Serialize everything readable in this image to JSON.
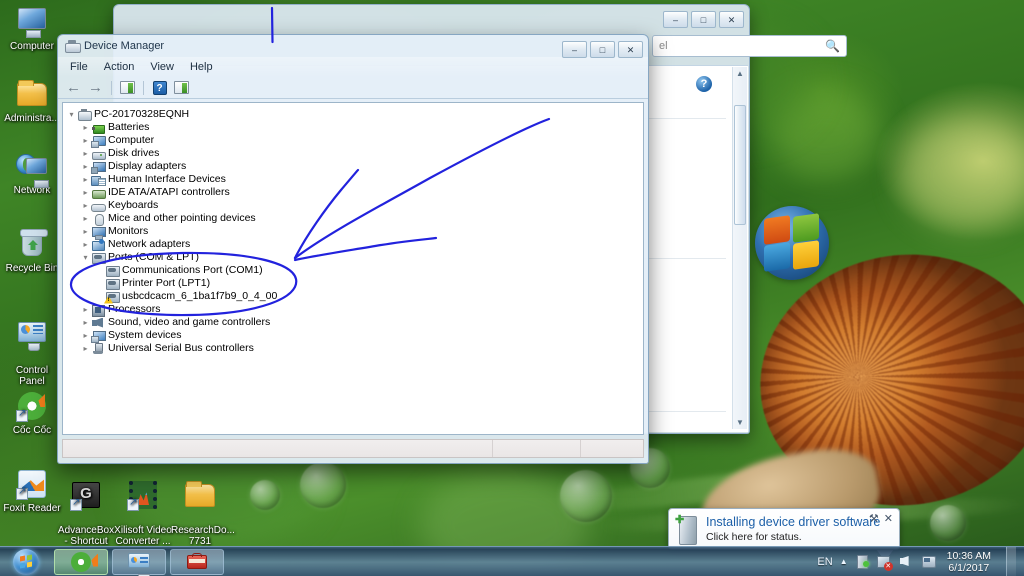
{
  "desktop": {
    "icons": [
      {
        "name": "computer",
        "label": "Computer"
      },
      {
        "name": "administrator-folder",
        "label": "Administra..."
      },
      {
        "name": "network",
        "label": "Network"
      },
      {
        "name": "recycle-bin",
        "label": "Recycle Bin"
      },
      {
        "name": "control-panel",
        "label": "Control\nPanel"
      },
      {
        "name": "coc-coc",
        "label": "Cốc Cốc"
      },
      {
        "name": "foxit-reader",
        "label": "Foxit Reader"
      },
      {
        "name": "advancebox-shortcut",
        "label": "AdvanceBox\n- Shortcut"
      },
      {
        "name": "xilisoft-video-converter",
        "label": "Xilisoft Video\nConverter ..."
      },
      {
        "name": "research-docs-folder",
        "label": "ResearchDo...\n7731"
      }
    ]
  },
  "background_window": {
    "search_placeholder": "",
    "search_value": "el",
    "buttons": {
      "minimize": "–",
      "maximize": "□",
      "close": "✕"
    },
    "help_label": "?"
  },
  "device_manager": {
    "title": "Device Manager",
    "window_buttons": {
      "minimize": "–",
      "maximize": "□",
      "close": "✕"
    },
    "menu": [
      "File",
      "Action",
      "View",
      "Help"
    ],
    "toolbar": [
      {
        "name": "back-arrow-button",
        "glyph": "←"
      },
      {
        "name": "forward-arrow-button",
        "glyph": "→"
      },
      {
        "name": "properties-button",
        "glyph": ""
      },
      {
        "name": "help-button",
        "glyph": "?"
      },
      {
        "name": "scan-hardware-button",
        "glyph": ""
      }
    ],
    "tree": [
      {
        "label": "PC-20170328EQNH",
        "depth": 0,
        "expander": "▾",
        "icon": "ic-pc",
        "warn": false
      },
      {
        "label": "Batteries",
        "depth": 1,
        "expander": "▸",
        "icon": "ic-batt",
        "warn": false
      },
      {
        "label": "Computer",
        "depth": 1,
        "expander": "▸",
        "icon": "ic-comp",
        "warn": false
      },
      {
        "label": "Disk drives",
        "depth": 1,
        "expander": "▸",
        "icon": "ic-disk",
        "warn": false
      },
      {
        "label": "Display adapters",
        "depth": 1,
        "expander": "▸",
        "icon": "ic-disp",
        "warn": false
      },
      {
        "label": "Human Interface Devices",
        "depth": 1,
        "expander": "▸",
        "icon": "ic-hid",
        "warn": false
      },
      {
        "label": "IDE ATA/ATAPI controllers",
        "depth": 1,
        "expander": "▸",
        "icon": "ic-ide",
        "warn": false
      },
      {
        "label": "Keyboards",
        "depth": 1,
        "expander": "▸",
        "icon": "ic-key",
        "warn": false
      },
      {
        "label": "Mice and other pointing devices",
        "depth": 1,
        "expander": "▸",
        "icon": "ic-mouse",
        "warn": false
      },
      {
        "label": "Monitors",
        "depth": 1,
        "expander": "▸",
        "icon": "ic-mon",
        "warn": false
      },
      {
        "label": "Network adapters",
        "depth": 1,
        "expander": "▸",
        "icon": "ic-net",
        "warn": false
      },
      {
        "label": "Ports (COM & LPT)",
        "depth": 1,
        "expander": "▾",
        "icon": "ic-port",
        "warn": false
      },
      {
        "label": "Communications Port (COM1)",
        "depth": 2,
        "expander": "",
        "icon": "ic-port",
        "warn": false
      },
      {
        "label": "Printer Port (LPT1)",
        "depth": 2,
        "expander": "",
        "icon": "ic-port",
        "warn": false
      },
      {
        "label": "usbcdcacm_6_1ba1f7b9_0_4_00",
        "depth": 2,
        "expander": "",
        "icon": "ic-port",
        "warn": true
      },
      {
        "label": "Processors",
        "depth": 1,
        "expander": "▸",
        "icon": "ic-proc",
        "warn": false
      },
      {
        "label": "Sound, video and game controllers",
        "depth": 1,
        "expander": "▸",
        "icon": "ic-snd",
        "warn": false
      },
      {
        "label": "System devices",
        "depth": 1,
        "expander": "▸",
        "icon": "ic-sys",
        "warn": false
      },
      {
        "label": "Universal Serial Bus controllers",
        "depth": 1,
        "expander": "▸",
        "icon": "ic-usb",
        "warn": false
      }
    ]
  },
  "notification": {
    "title": "Installing device driver software",
    "subtitle": "Click here for status.",
    "options_glyph": "⚒",
    "close_glyph": "✕"
  },
  "taskbar": {
    "start_label": "Start",
    "items": [
      {
        "name": "taskbar-coc-coc",
        "label": ""
      },
      {
        "name": "taskbar-control-panel",
        "label": ""
      },
      {
        "name": "taskbar-device-manager",
        "label": ""
      }
    ],
    "tray": {
      "language": "EN",
      "chevron": "▲",
      "icons": [
        "install-icon",
        "network-error-icon",
        "speaker-icon",
        "action-center-icon"
      ]
    },
    "clock": {
      "time": "10:36 AM",
      "date": "6/1/2017"
    }
  },
  "annotations": {
    "ink_color": "#2222dd",
    "shapes": [
      "vertical-stroke",
      "arrow-three-strokes",
      "ellipse-highlight"
    ]
  }
}
